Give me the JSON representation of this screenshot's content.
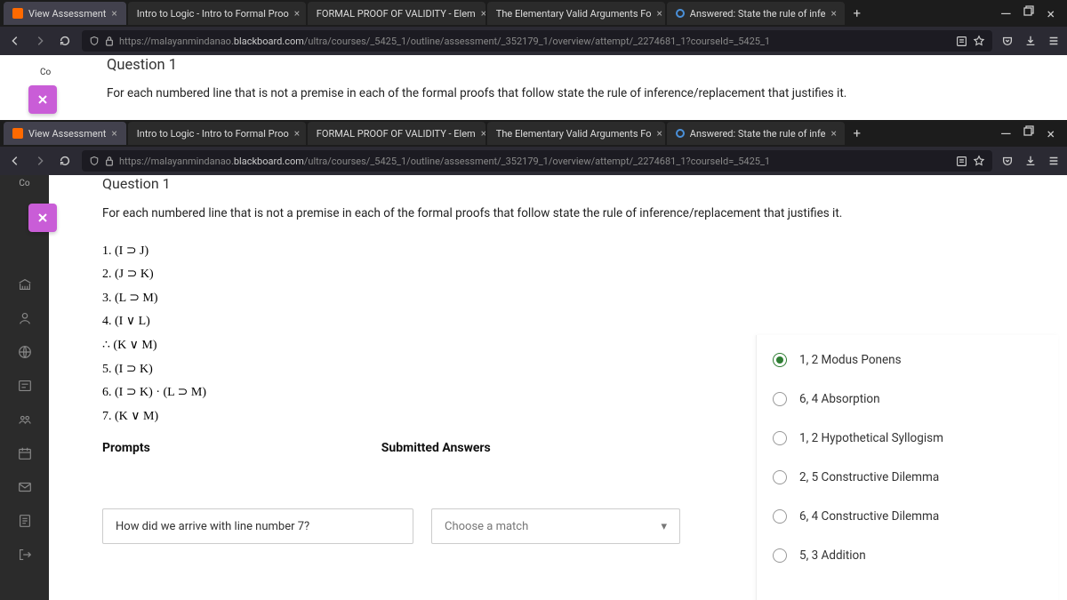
{
  "tabs": [
    {
      "label": "View Assessment"
    },
    {
      "label": "Intro to Logic - Intro to Formal Proo"
    },
    {
      "label": "FORMAL PROOF OF VALIDITY - Elem"
    },
    {
      "label": "The Elementary Valid Arguments Fo"
    },
    {
      "label": "Answered: State the rule of infe"
    }
  ],
  "url": {
    "prefix": "https://malayanmindanao.",
    "host": "blackboard.com",
    "path": "/ultra/courses/_5425_1/outline/assessment/_352179_1/overview/attempt/_2274681_1?courseId=_5425_1"
  },
  "question_title": "Question 1",
  "instruction": "For each numbered line that is not a premise in each of the formal proofs that follow state the rule of inference/replacement that justifies it.",
  "proof_lines": [
    "1. (I ⊃ J)",
    "2. (J ⊃ K)",
    "3. (L ⊃ M)",
    "4. (I ∨ L)",
    "∴ (K ∨ M)",
    "5. (I ⊃ K)",
    "6. (I ⊃ K) · (L ⊃ M)",
    "7. (K ∨ M)"
  ],
  "prompts_header": "Prompts",
  "submitted_header": "Submitted Answers",
  "prompt_text": "How did we arrive with line number 7?",
  "match_placeholder": "Choose a match",
  "answers": [
    {
      "label": "1, 2 Modus Ponens",
      "selected": true
    },
    {
      "label": "6, 4 Absorption",
      "selected": false
    },
    {
      "label": "1, 2 Hypothetical Syllogism",
      "selected": false
    },
    {
      "label": "2, 5 Constructive Dilemma",
      "selected": false
    },
    {
      "label": "6, 4 Constructive Dilemma",
      "selected": false
    },
    {
      "label": "5, 3 Addition",
      "selected": false
    }
  ],
  "cc": "Co"
}
